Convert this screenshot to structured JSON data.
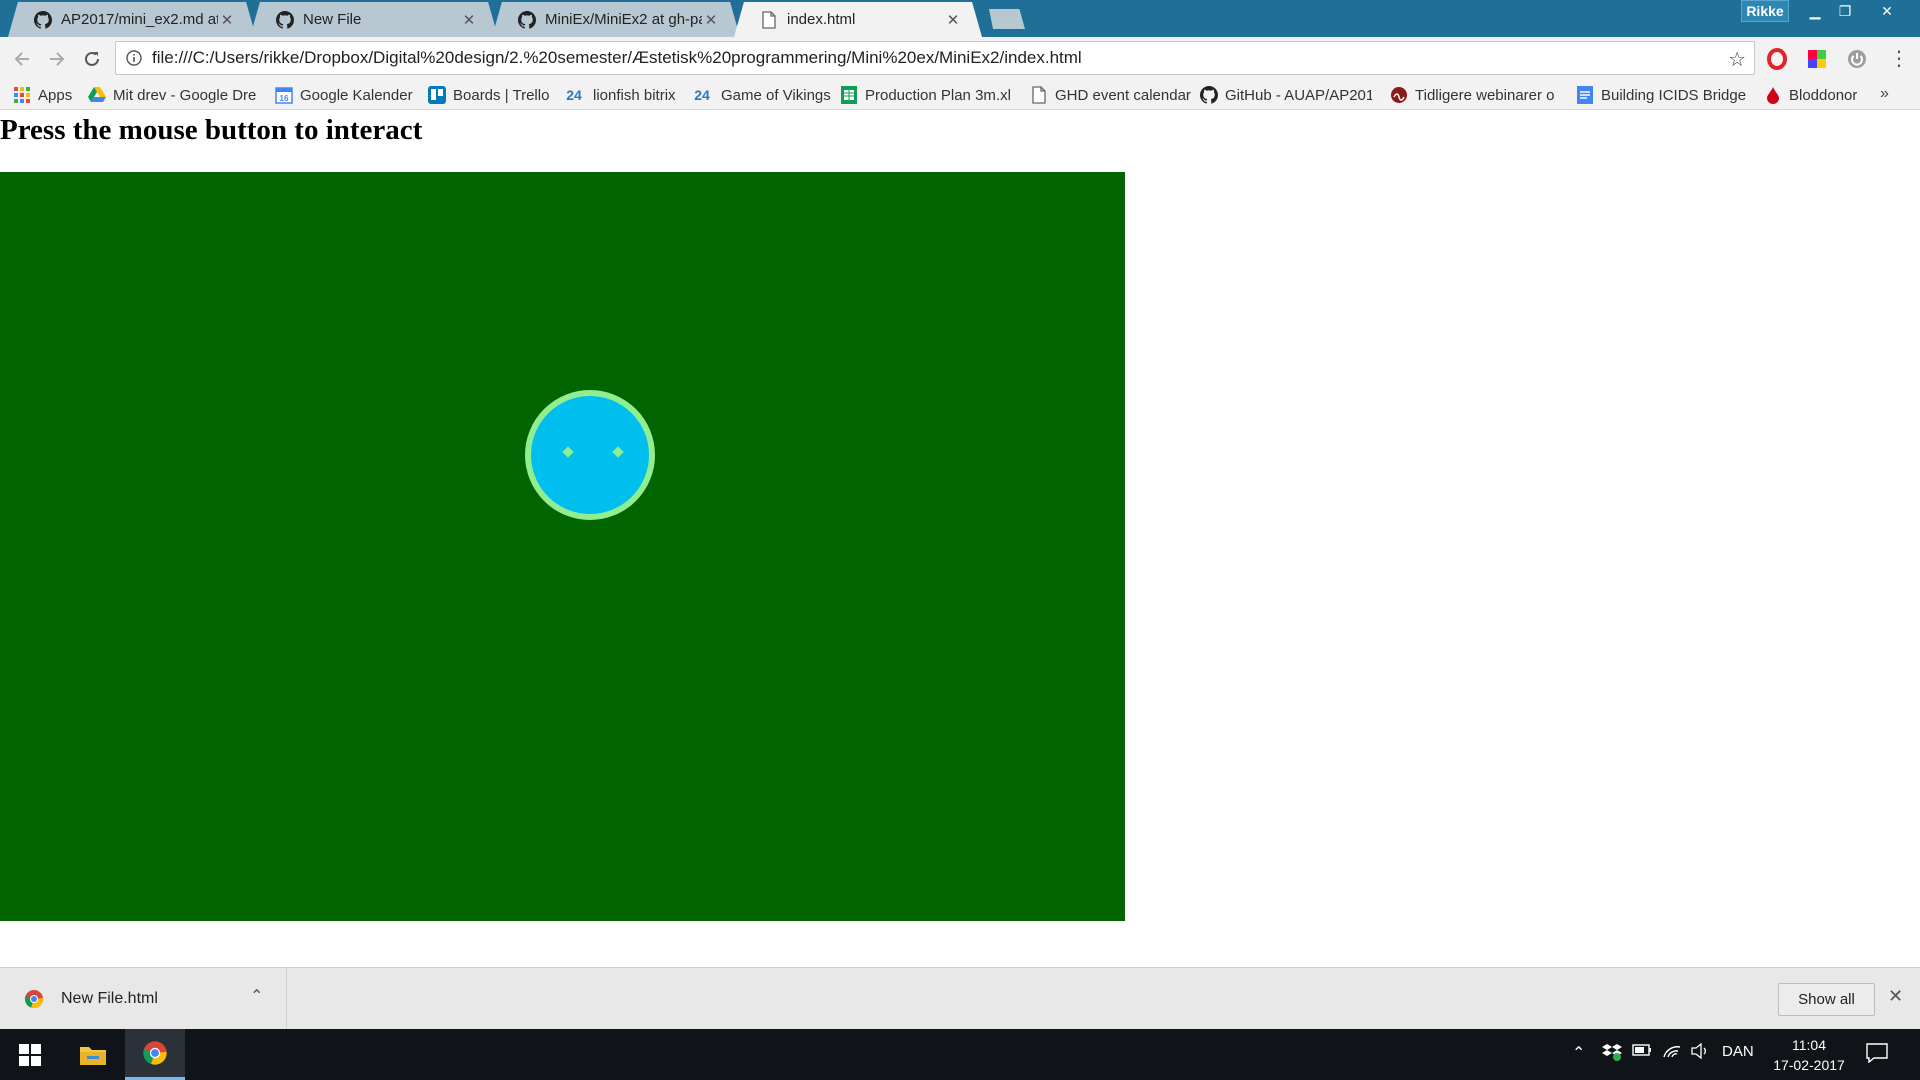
{
  "browser": {
    "tabs": [
      {
        "title": "AP2017/mini_ex2.md at r",
        "icon": "github-icon",
        "active": false
      },
      {
        "title": "New File",
        "icon": "github-icon",
        "active": false
      },
      {
        "title": "MiniEx/MiniEx2 at gh-pa",
        "icon": "github-icon",
        "active": false
      },
      {
        "title": "index.html",
        "icon": "file-icon",
        "active": true
      }
    ],
    "profile_name": "Rikke",
    "address": "file:///C:/Users/rikke/Dropbox/Digital%20design/2.%20semester/Æstetisk%20programmering/Mini%20ex/MiniEx2/index.html",
    "bookmarks": [
      {
        "label": "Apps",
        "icon": "apps-grid-icon"
      },
      {
        "label": "Mit drev - Google Dre",
        "icon": "google-drive-icon"
      },
      {
        "label": "Google Kalender",
        "icon": "calendar-icon"
      },
      {
        "label": "Boards | Trello",
        "icon": "trello-icon"
      },
      {
        "label": "lionfish bitrix",
        "icon": "bitrix24-icon"
      },
      {
        "label": "Game of Vikings",
        "icon": "bitrix24-icon"
      },
      {
        "label": "Production Plan 3m.xl",
        "icon": "sheets-icon"
      },
      {
        "label": "GHD event calendar",
        "icon": "page-icon"
      },
      {
        "label": "GitHub - AUAP/AP201",
        "icon": "github-icon"
      },
      {
        "label": "Tidligere webinarer o",
        "icon": "webinar-icon"
      },
      {
        "label": "Building ICIDS Bridge",
        "icon": "docs-icon"
      },
      {
        "label": "Bloddonor",
        "icon": "blood-drop-icon"
      }
    ],
    "bookmarks_overflow": "»"
  },
  "page": {
    "heading": "Press the mouse button to interact",
    "canvas_color": "#006400",
    "face_color": "#00bfef",
    "face_outline_color": "#90ee90"
  },
  "downloads": {
    "file_name": "New File.html",
    "show_all_label": "Show all"
  },
  "taskbar": {
    "language": "DAN",
    "time": "11:04",
    "date": "17-02-2017"
  }
}
